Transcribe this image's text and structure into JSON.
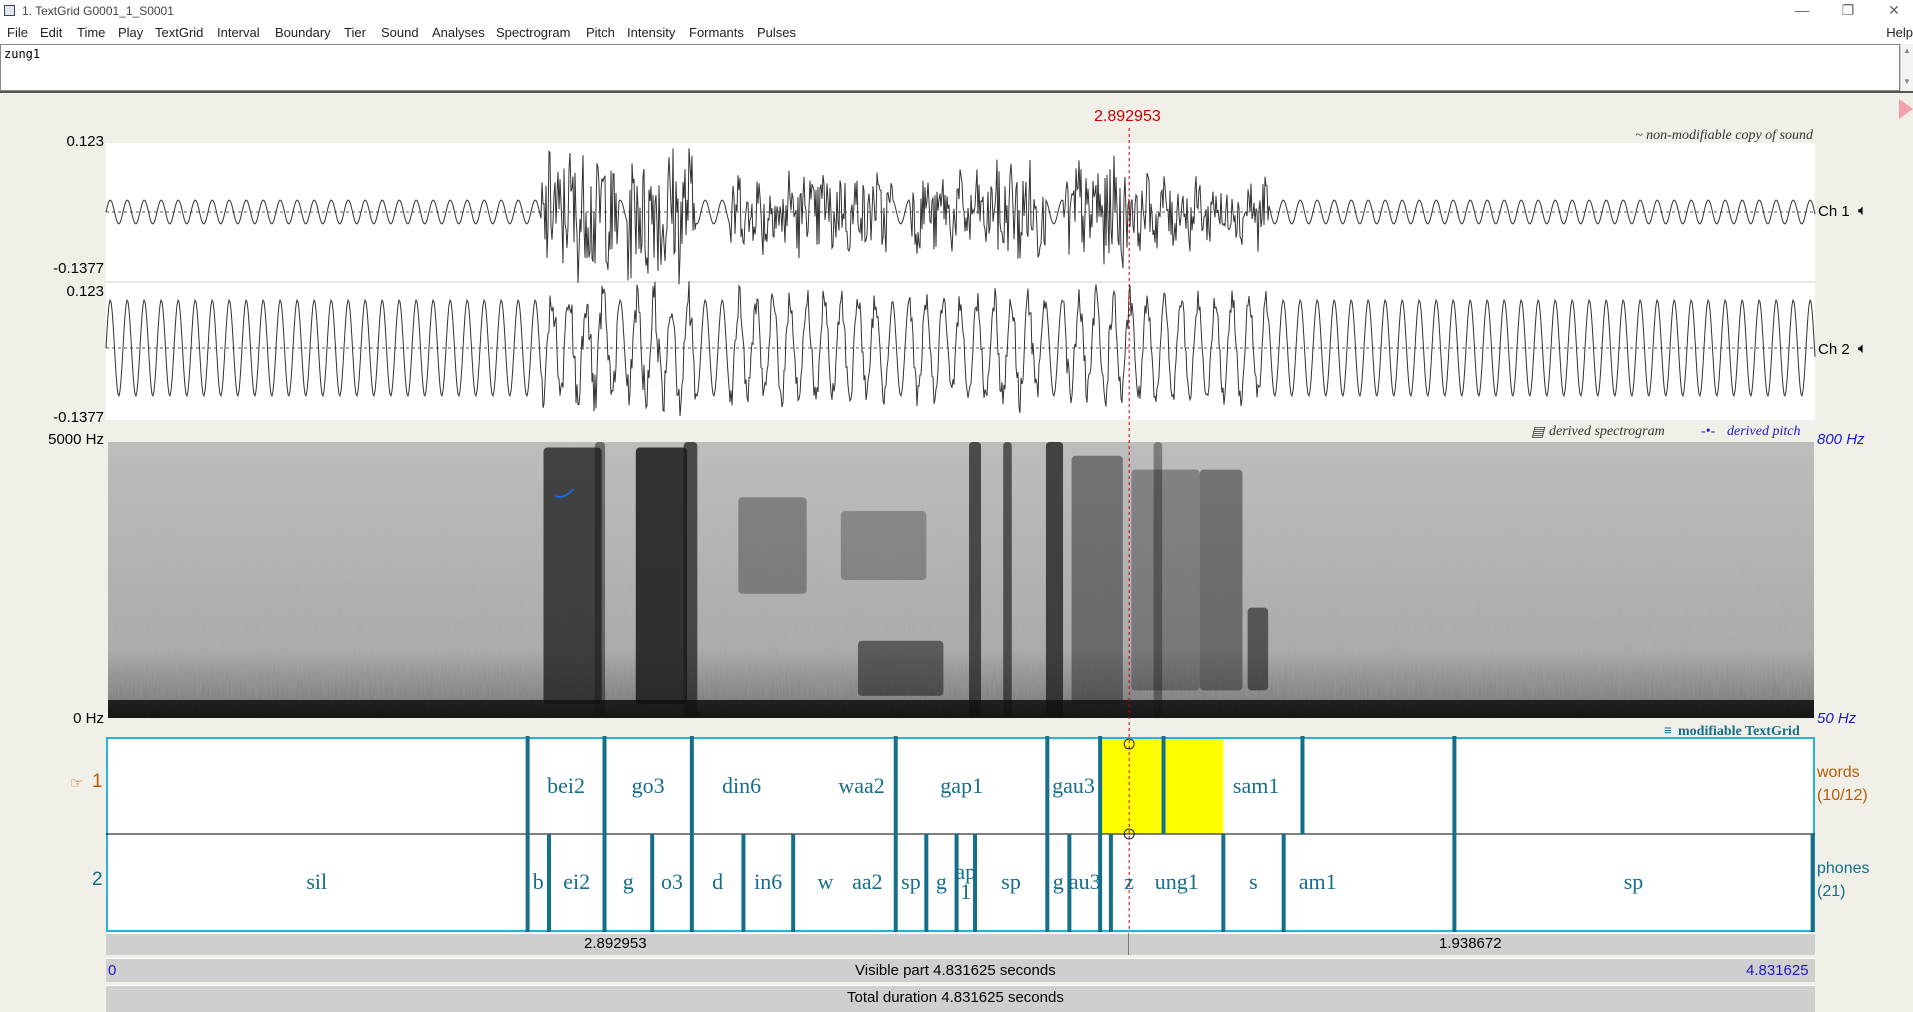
{
  "window": {
    "title": "1. TextGrid G0001_1_S0001",
    "min": "—",
    "restore": "❐",
    "close": "✕"
  },
  "menu": [
    "File",
    "Edit",
    "Time",
    "Play",
    "TextGrid",
    "Interval",
    "Boundary",
    "Tier",
    "Sound",
    "Analyses",
    "Spectrogram",
    "Pitch",
    "Intensity",
    "Formants",
    "Pulses"
  ],
  "help": "Help",
  "text_field": {
    "value": "zung1"
  },
  "cursor": {
    "time": "2.892953",
    "fraction": 0.5987
  },
  "sound": {
    "note": "~ non-modifiable copy of sound",
    "ch1": {
      "max": "0.123",
      "min": "-0.1377",
      "label": "Ch 1"
    },
    "ch2": {
      "max": "0.123",
      "min": "-0.1377",
      "label": "Ch 2"
    }
  },
  "spectrogram": {
    "top": "5000 Hz",
    "bottom": "0 Hz",
    "pitch_top": "800 Hz",
    "pitch_bottom": "50 Hz",
    "note_spectrogram": "derived spectrogram",
    "note_pitch": "derived pitch"
  },
  "textgrid": {
    "note": "modifiable TextGrid",
    "tiers": [
      {
        "number": "1",
        "name": "words",
        "count": "(10/12)",
        "boundaries": [
          0.2467,
          0.2917,
          0.3428,
          0.4621,
          0.5508,
          0.5817,
          0.6188,
          0.7001,
          0.789
        ],
        "labels": [
          {
            "t": "bei2",
            "c": 0.2692
          },
          {
            "t": "go3",
            "c": 0.3172
          },
          {
            "t": "din6",
            "c": 0.3719
          },
          {
            "t": "waa2",
            "c": 0.4421
          },
          {
            "t": "gap1",
            "c": 0.5007
          },
          {
            "t": "gau3",
            "c": 0.5661
          },
          {
            "t": "zung1",
            "c": 0.6174,
            "selected": true
          },
          {
            "t": "sam1",
            "c": 0.673
          }
        ],
        "selected": {
          "start": 0.5817,
          "end": 0.6538
        }
      },
      {
        "number": "2",
        "name": "phones",
        "count": "(21)",
        "boundaries": [
          0.2467,
          0.2592,
          0.2917,
          0.3196,
          0.3428,
          0.373,
          0.4021,
          0.4621,
          0.48,
          0.4977,
          0.5085,
          0.5508,
          0.5637,
          0.5817,
          0.588,
          0.6538,
          0.6891,
          0.789,
          0.9986
        ],
        "labels": [
          {
            "t": "sil",
            "c": 0.1233
          },
          {
            "t": "b",
            "c": 0.2529
          },
          {
            "t": "ei2",
            "c": 0.2754
          },
          {
            "t": "g",
            "c": 0.3056
          },
          {
            "t": "o3",
            "c": 0.3312
          },
          {
            "t": "d",
            "c": 0.3579
          },
          {
            "t": "in6",
            "c": 0.3875
          },
          {
            "t": "w",
            "c": 0.421
          },
          {
            "t": "aa2",
            "c": 0.4455
          },
          {
            "t": "sp",
            "c": 0.471
          },
          {
            "t": "g",
            "c": 0.4888
          },
          {
            "t": "ap\n1",
            "c": 0.5031
          },
          {
            "t": "sp",
            "c": 0.5296
          },
          {
            "t": "g",
            "c": 0.5572
          },
          {
            "t": "au3",
            "c": 0.5727
          },
          {
            "t": "z",
            "c": 0.5987
          },
          {
            "t": "ung1",
            "c": 0.6265
          },
          {
            "t": "s",
            "c": 0.6714
          },
          {
            "t": "am1",
            "c": 0.709
          },
          {
            "t": "sp",
            "c": 0.8938
          }
        ]
      }
    ]
  },
  "bars": {
    "left_duration": "2.892953",
    "right_duration": "1.938672",
    "visible_start": "0",
    "visible_label": "Visible part 4.831625 seconds",
    "visible_end": "4.831625",
    "total_label": "Total duration 4.831625 seconds"
  },
  "colors": {
    "accent": "#156e8a",
    "selection": "#ffff00",
    "cursor": "#cc0000",
    "tier_border": "#26b5d8",
    "pitch": "#1a1acc"
  }
}
